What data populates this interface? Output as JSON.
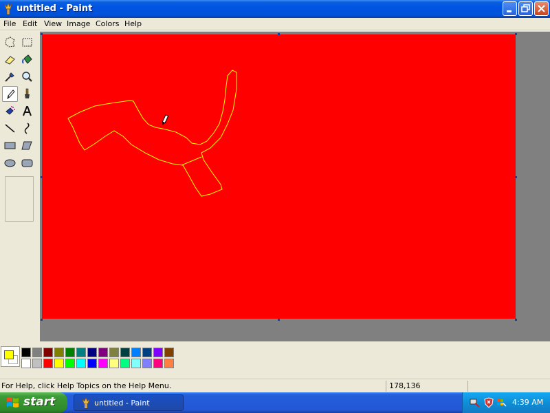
{
  "window": {
    "title": "untitled - Paint"
  },
  "menu": [
    "File",
    "Edit",
    "View",
    "Image",
    "Colors",
    "Help"
  ],
  "tools": [
    {
      "icon": "free-form-select-icon"
    },
    {
      "icon": "rect-select-icon"
    },
    {
      "icon": "eraser-icon"
    },
    {
      "icon": "fill-icon"
    },
    {
      "icon": "color-picker-icon"
    },
    {
      "icon": "magnifier-icon"
    },
    {
      "icon": "pencil-icon",
      "active": true
    },
    {
      "icon": "brush-icon"
    },
    {
      "icon": "airbrush-icon"
    },
    {
      "icon": "text-icon"
    },
    {
      "icon": "line-icon"
    },
    {
      "icon": "curve-icon"
    },
    {
      "icon": "rectangle-icon"
    },
    {
      "icon": "polygon-icon"
    },
    {
      "icon": "ellipse-icon"
    },
    {
      "icon": "rounded-rectangle-icon"
    }
  ],
  "canvas": {
    "background_color": "#ff0000",
    "stroke_color": "#ffff00"
  },
  "current_colors": {
    "foreground": "#ffff00",
    "background": "#ffffff"
  },
  "palette": {
    "top_row": [
      "#000000",
      "#808080",
      "#800000",
      "#808000",
      "#008000",
      "#008080",
      "#000080",
      "#800080",
      "#808040",
      "#004040",
      "#0080ff",
      "#004080",
      "#8000ff",
      "#804000"
    ],
    "bottom_row": [
      "#ffffff",
      "#c0c0c0",
      "#ff0000",
      "#ffff00",
      "#00ff00",
      "#00ffff",
      "#0000ff",
      "#ff00ff",
      "#ffff80",
      "#00ff80",
      "#80ffff",
      "#8080ff",
      "#ff0080",
      "#ff8040"
    ]
  },
  "status": {
    "help_text": "For Help, click Help Topics on the Help Menu.",
    "coordinates": "178,136"
  },
  "taskbar": {
    "start_label": "start",
    "task_label": "untitled - Paint",
    "clock": "4:39 AM"
  }
}
